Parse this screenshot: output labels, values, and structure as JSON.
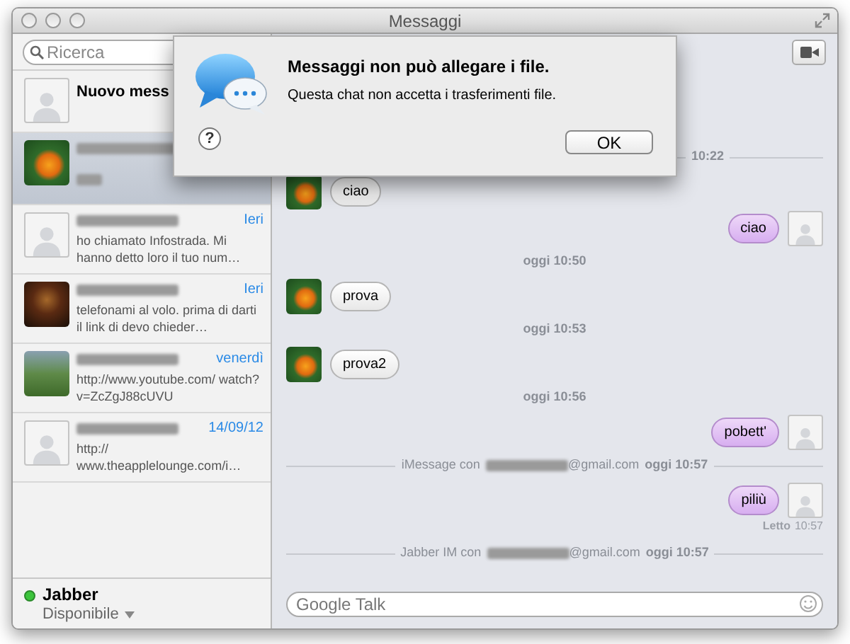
{
  "window": {
    "title": "Messaggi"
  },
  "sidebar": {
    "search": {
      "placeholder": "Ricerca"
    },
    "conversations": [
      {
        "kind": "new",
        "title": "Nuovo mess",
        "has_photo": false,
        "selected": false
      },
      {
        "kind": "chat",
        "has_photo": true,
        "selected": true
      },
      {
        "kind": "chat",
        "has_photo": false,
        "selected": false,
        "date": "Ieri",
        "preview": "ho chiamato Infostrada. Mi hanno detto loro il tuo num…"
      },
      {
        "kind": "chat",
        "has_photo": true,
        "selected": false,
        "date": "Ieri",
        "preview": "telefonami al volo. prima di darti il link di devo chieder…"
      },
      {
        "kind": "chat",
        "has_photo": true,
        "selected": false,
        "date": "venerdì",
        "preview": "http://www.youtube.com/ watch?v=ZcZgJ88cUVU"
      },
      {
        "kind": "chat",
        "has_photo": false,
        "selected": false,
        "date": "14/09/12",
        "preview": "http:// www.theapplelounge.com/i…"
      }
    ],
    "account": {
      "name": "Jabber",
      "status": "Disponibile",
      "online": true
    }
  },
  "chat": {
    "messages": [
      {
        "kind": "service",
        "after": "10:22"
      },
      {
        "kind": "in",
        "text": "ciao"
      },
      {
        "kind": "out",
        "text": "ciao"
      },
      {
        "kind": "time",
        "text": "oggi 10:50"
      },
      {
        "kind": "in",
        "text": "prova"
      },
      {
        "kind": "time",
        "text": "oggi 10:53"
      },
      {
        "kind": "in",
        "text": "prova2"
      },
      {
        "kind": "time",
        "text": "oggi 10:56"
      },
      {
        "kind": "out",
        "text": "pobett'"
      },
      {
        "kind": "service",
        "before": "iMessage con",
        "domain": "@gmail.com",
        "after": "oggi 10:57"
      },
      {
        "kind": "out",
        "text": "piliù"
      },
      {
        "kind": "receipt",
        "label": "Letto",
        "time": "10:57"
      },
      {
        "kind": "service",
        "before": "Jabber IM con",
        "domain": "@gmail.com",
        "after": "oggi 10:57"
      }
    ],
    "input": {
      "placeholder": "Google Talk"
    }
  },
  "dialog": {
    "title": "Messaggi non può allegare i file.",
    "message": "Questa chat non accetta i trasferimenti file.",
    "help": "?",
    "button": "OK"
  }
}
